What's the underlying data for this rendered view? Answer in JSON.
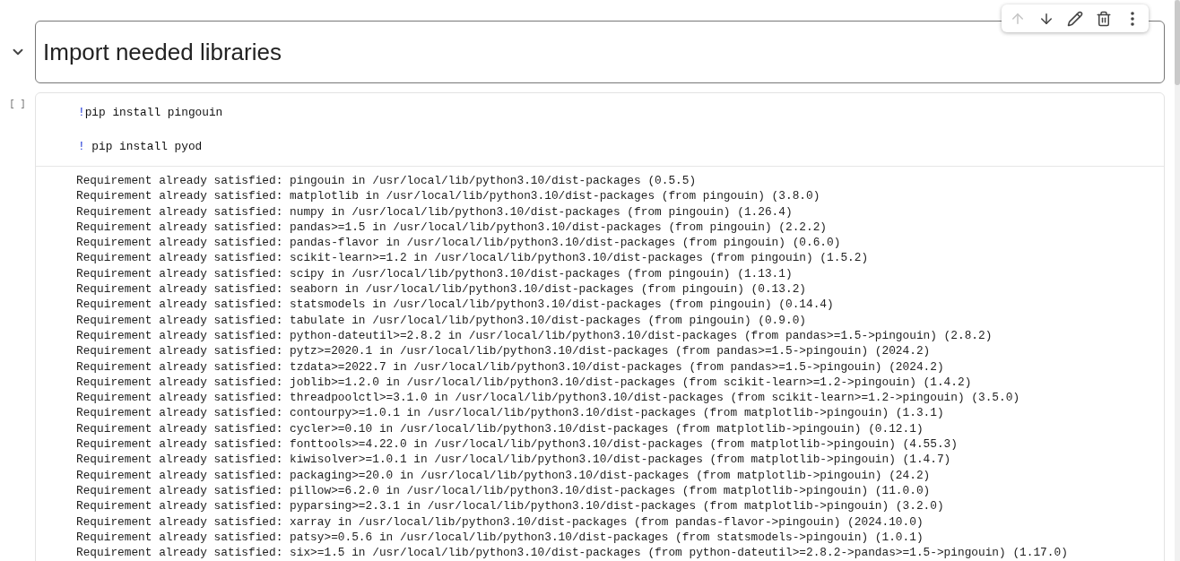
{
  "cell_toolbar": [
    {
      "kind": "up",
      "disabled": true
    },
    {
      "kind": "down",
      "disabled": false
    },
    {
      "kind": "edit",
      "disabled": false
    },
    {
      "kind": "delete",
      "disabled": false
    },
    {
      "kind": "more",
      "disabled": false
    }
  ],
  "text_cell": {
    "expanded": true,
    "heading": "Import needed libraries"
  },
  "code_cell": {
    "run_label": "[ ]",
    "lines": [
      {
        "bang": "!",
        "code": "pip install pingouin"
      },
      {
        "bang": "!",
        "code": " pip install pyod"
      }
    ],
    "output": [
      "Requirement already satisfied: pingouin in /usr/local/lib/python3.10/dist-packages (0.5.5)",
      "Requirement already satisfied: matplotlib in /usr/local/lib/python3.10/dist-packages (from pingouin) (3.8.0)",
      "Requirement already satisfied: numpy in /usr/local/lib/python3.10/dist-packages (from pingouin) (1.26.4)",
      "Requirement already satisfied: pandas>=1.5 in /usr/local/lib/python3.10/dist-packages (from pingouin) (2.2.2)",
      "Requirement already satisfied: pandas-flavor in /usr/local/lib/python3.10/dist-packages (from pingouin) (0.6.0)",
      "Requirement already satisfied: scikit-learn>=1.2 in /usr/local/lib/python3.10/dist-packages (from pingouin) (1.5.2)",
      "Requirement already satisfied: scipy in /usr/local/lib/python3.10/dist-packages (from pingouin) (1.13.1)",
      "Requirement already satisfied: seaborn in /usr/local/lib/python3.10/dist-packages (from pingouin) (0.13.2)",
      "Requirement already satisfied: statsmodels in /usr/local/lib/python3.10/dist-packages (from pingouin) (0.14.4)",
      "Requirement already satisfied: tabulate in /usr/local/lib/python3.10/dist-packages (from pingouin) (0.9.0)",
      "Requirement already satisfied: python-dateutil>=2.8.2 in /usr/local/lib/python3.10/dist-packages (from pandas>=1.5->pingouin) (2.8.2)",
      "Requirement already satisfied: pytz>=2020.1 in /usr/local/lib/python3.10/dist-packages (from pandas>=1.5->pingouin) (2024.2)",
      "Requirement already satisfied: tzdata>=2022.7 in /usr/local/lib/python3.10/dist-packages (from pandas>=1.5->pingouin) (2024.2)",
      "Requirement already satisfied: joblib>=1.2.0 in /usr/local/lib/python3.10/dist-packages (from scikit-learn>=1.2->pingouin) (1.4.2)",
      "Requirement already satisfied: threadpoolctl>=3.1.0 in /usr/local/lib/python3.10/dist-packages (from scikit-learn>=1.2->pingouin) (3.5.0)",
      "Requirement already satisfied: contourpy>=1.0.1 in /usr/local/lib/python3.10/dist-packages (from matplotlib->pingouin) (1.3.1)",
      "Requirement already satisfied: cycler>=0.10 in /usr/local/lib/python3.10/dist-packages (from matplotlib->pingouin) (0.12.1)",
      "Requirement already satisfied: fonttools>=4.22.0 in /usr/local/lib/python3.10/dist-packages (from matplotlib->pingouin) (4.55.3)",
      "Requirement already satisfied: kiwisolver>=1.0.1 in /usr/local/lib/python3.10/dist-packages (from matplotlib->pingouin) (1.4.7)",
      "Requirement already satisfied: packaging>=20.0 in /usr/local/lib/python3.10/dist-packages (from matplotlib->pingouin) (24.2)",
      "Requirement already satisfied: pillow>=6.2.0 in /usr/local/lib/python3.10/dist-packages (from matplotlib->pingouin) (11.0.0)",
      "Requirement already satisfied: pyparsing>=2.3.1 in /usr/local/lib/python3.10/dist-packages (from matplotlib->pingouin) (3.2.0)",
      "Requirement already satisfied: xarray in /usr/local/lib/python3.10/dist-packages (from pandas-flavor->pingouin) (2024.10.0)",
      "Requirement already satisfied: patsy>=0.5.6 in /usr/local/lib/python3.10/dist-packages (from statsmodels->pingouin) (1.0.1)",
      "Requirement already satisfied: six>=1.5 in /usr/local/lib/python3.10/dist-packages (from python-dateutil>=2.8.2->pandas>=1.5->pingouin) (1.17.0)"
    ]
  }
}
